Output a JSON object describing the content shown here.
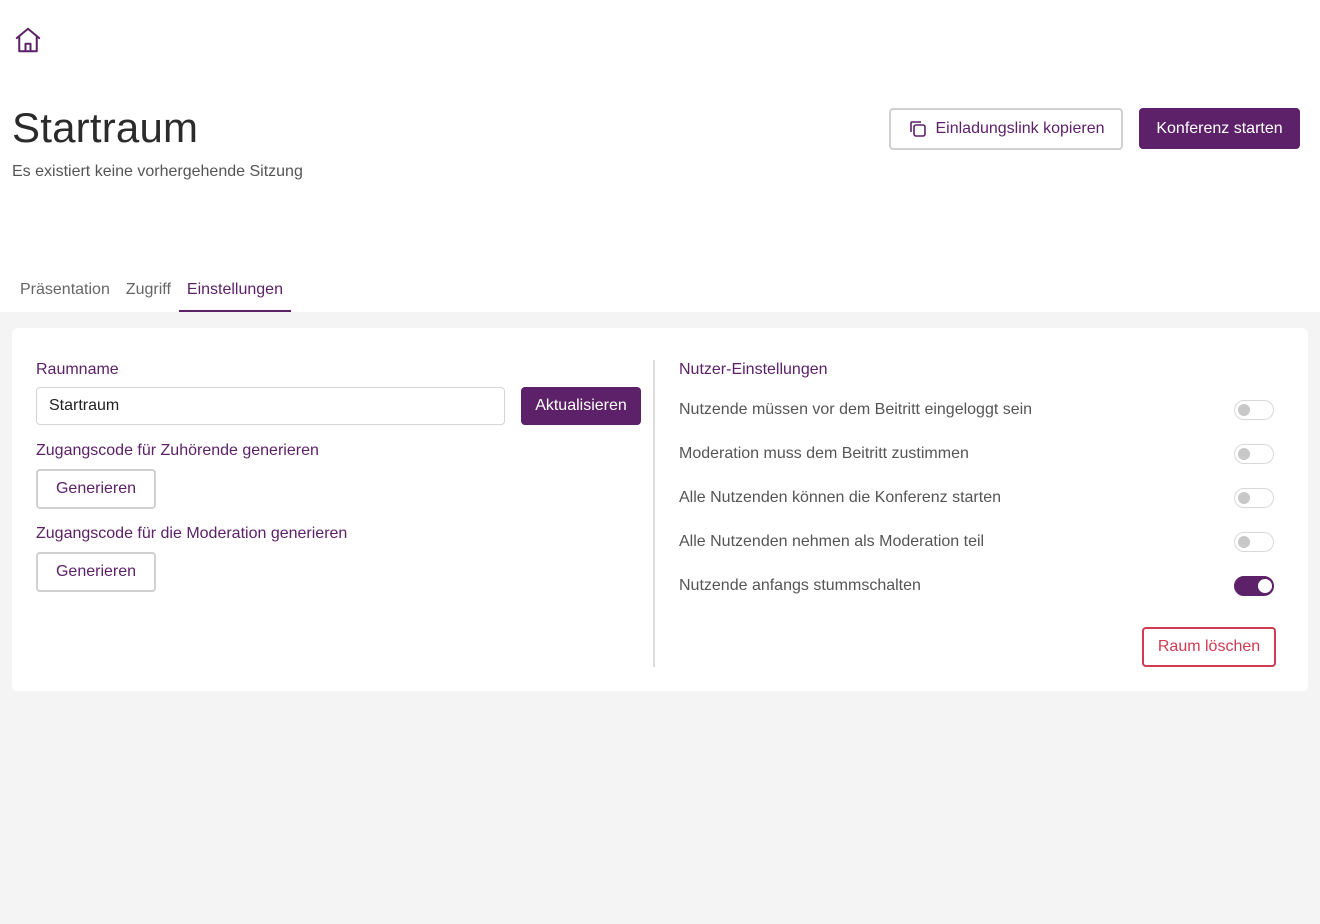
{
  "header": {
    "title": "Startraum",
    "subtitle": "Es existiert keine vorhergehende Sitzung",
    "invite_label": "Einladungslink kopieren",
    "start_label": "Konferenz starten"
  },
  "tabs": [
    {
      "label": "Präsentation"
    },
    {
      "label": "Zugriff"
    },
    {
      "label": "Einstellungen",
      "active": true
    }
  ],
  "room": {
    "name_label": "Raumname",
    "name_value": "Startraum",
    "update_label": "Aktualisieren",
    "listener_code_label": "Zugangscode für Zuhörende generieren",
    "moderation_code_label": "Zugangscode für die Moderation generieren",
    "generate_label": "Generieren"
  },
  "user_settings": {
    "heading": "Nutzer-Einstellungen",
    "items": [
      {
        "label": "Nutzende müssen vor dem Beitritt eingeloggt sein",
        "enabled": false
      },
      {
        "label": "Moderation muss dem Beitritt zustimmen",
        "enabled": false
      },
      {
        "label": "Alle Nutzenden können die Konferenz starten",
        "enabled": false
      },
      {
        "label": "Alle Nutzenden nehmen als Moderation teil",
        "enabled": false
      },
      {
        "label": "Nutzende anfangs stummschalten",
        "enabled": true
      }
    ],
    "delete_label": "Raum löschen"
  },
  "colors": {
    "brand": "#5c2168",
    "danger": "#d03a52",
    "background": "#f4f4f4"
  },
  "icons": {
    "home": "home-icon",
    "copy": "copy-icon"
  }
}
